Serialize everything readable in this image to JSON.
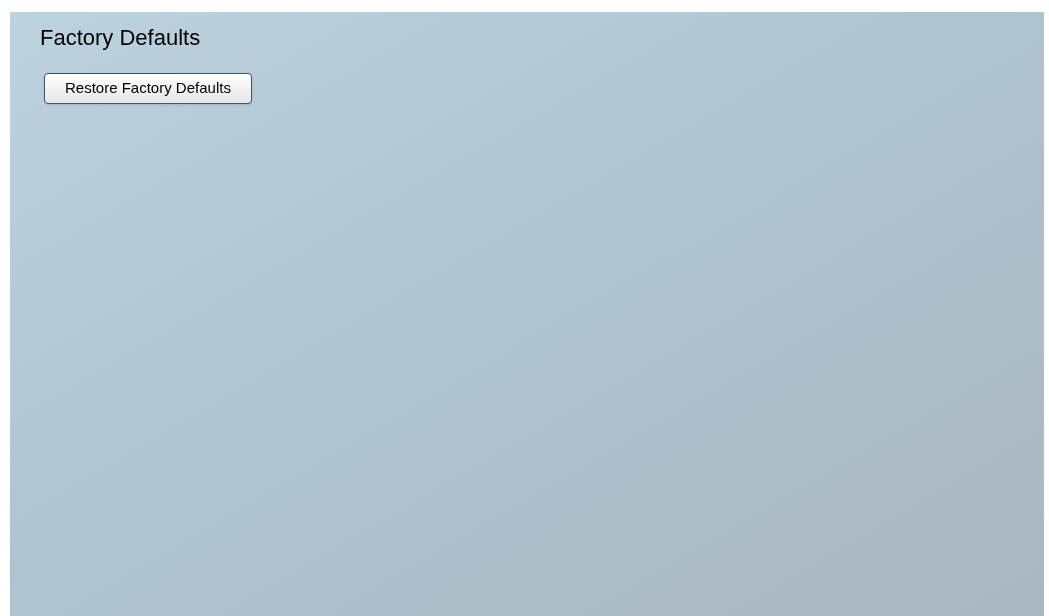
{
  "page": {
    "title": "Factory Defaults"
  },
  "buttons": [
    {
      "label": "Restore Factory Defaults"
    }
  ]
}
